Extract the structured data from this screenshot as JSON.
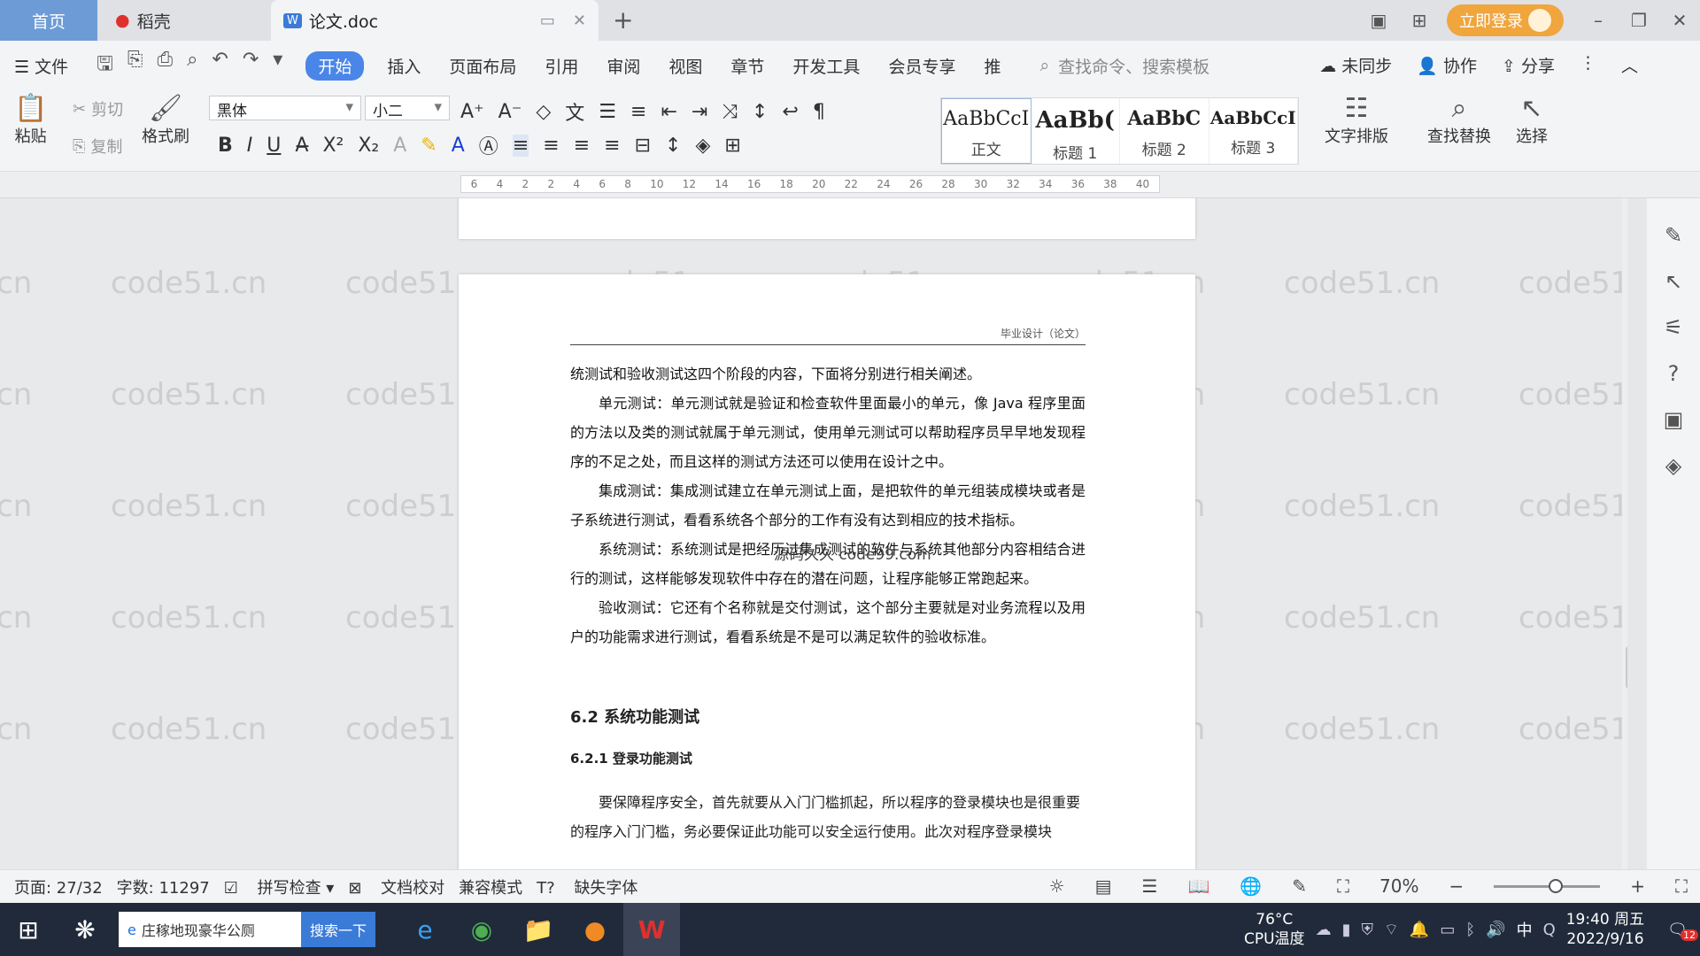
{
  "tabs": {
    "home": "首页",
    "daoke": "稻壳",
    "doc": "论文.doc"
  },
  "titlebar": {
    "login": "立即登录"
  },
  "menu": {
    "file": "文件",
    "items": [
      "开始",
      "插入",
      "页面布局",
      "引用",
      "审阅",
      "视图",
      "章节",
      "开发工具",
      "会员专享",
      "推"
    ],
    "search": "查找命令、搜索模板",
    "sync": "未同步",
    "collab": "协作",
    "share": "分享"
  },
  "ribbon": {
    "paste": "粘贴",
    "cut": "剪切",
    "copy": "复制",
    "painter": "格式刷",
    "font": "黑体",
    "size": "小二",
    "styles": [
      {
        "preview": "AaBbCcI",
        "name": "正文"
      },
      {
        "preview": "AaBb(",
        "name": "标题 1"
      },
      {
        "preview": "AaBbC",
        "name": "标题 2"
      },
      {
        "preview": "AaBbCcI",
        "name": "标题 3"
      }
    ],
    "layout": "文字排版",
    "find": "查找替换",
    "select": "选择"
  },
  "ruler_ticks": [
    "6",
    "4",
    "2",
    "2",
    "4",
    "6",
    "8",
    "10",
    "12",
    "14",
    "16",
    "18",
    "20",
    "22",
    "24",
    "26",
    "28",
    "30",
    "32",
    "34",
    "36",
    "38",
    "40"
  ],
  "watermark": "code51.cn",
  "document": {
    "header": "毕业设计（论文）",
    "paragraphs": [
      "统测试和验收测试这四个阶段的内容，下面将分别进行相关阐述。",
      "单元测试：单元测试就是验证和检查软件里面最小的单元，像 Java 程序里面的方法以及类的测试就属于单元测试，使用单元测试可以帮助程序员早早地发现程序的不足之处，而且这样的测试方法还可以使用在设计之中。",
      "集成测试：集成测试建立在单元测试上面，是把软件的单元组装成模块或者是子系统进行测试，看看系统各个部分的工作有没有达到相应的技术指标。",
      "系统测试：系统测试是把经历过集成测试的软件与系统其他部分内容相结合进行的测试，这样能够发现软件中存在的潜在问题，让程序能够正常跑起来。",
      "验收测试：它还有个名称就是交付测试，这个部分主要就是对业务流程以及用户的功能需求进行测试，看看系统是不是可以满足软件的验收标准。"
    ],
    "overlay": "源码久久 code99.com",
    "h2": "6.2  系统功能测试",
    "h3": "6.2.1  登录功能测试",
    "para2": "要保障程序安全，首先就要从入门门槛抓起，所以程序的登录模块也是很重要的程序入门门槛，务必要保证此功能可以安全运行使用。此次对程序登录模块"
  },
  "status": {
    "page": "页面: 27/32",
    "words": "字数: 11297",
    "spell": "拼写检查",
    "proof": "文档校对",
    "compat": "兼容模式",
    "missing_font": "缺失字体",
    "zoom": "70%"
  },
  "taskbar": {
    "search_text": "庄稼地现豪华公厕",
    "search_btn": "搜索一下",
    "temp": "76°C",
    "cpu": "CPU温度",
    "time": "19:40 周五",
    "date": "2022/9/16",
    "lang": "中",
    "badge": "12"
  }
}
